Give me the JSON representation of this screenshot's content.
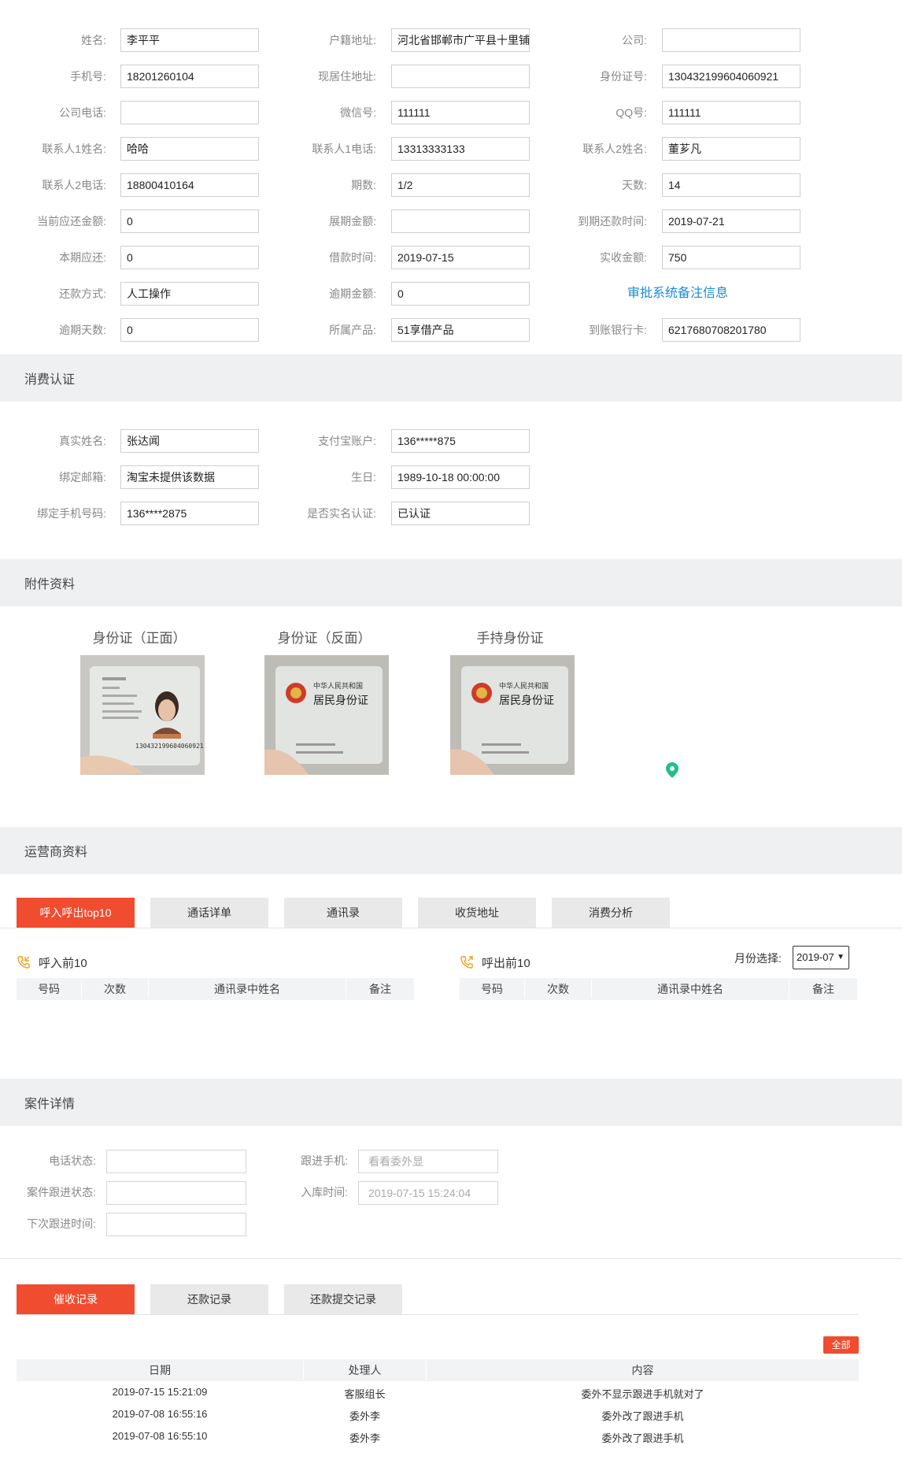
{
  "basic": {
    "name_label": "姓名:",
    "name": "李平平",
    "hukou_label": "户籍地址:",
    "hukou": "河北省邯郸市广平县十里铺",
    "company_label": "公司:",
    "company": "",
    "phone_label": "手机号:",
    "phone": "18201260104",
    "residence_label": "现居住地址:",
    "residence": "",
    "idno_label": "身份证号:",
    "idno": "130432199604060921",
    "company_phone_label": "公司电话:",
    "company_phone": "",
    "wechat_label": "微信号:",
    "wechat": "111111",
    "qq_label": "QQ号:",
    "qq": "111111",
    "contact1_name_label": "联系人1姓名:",
    "contact1_name": "哈哈",
    "contact1_phone_label": "联系人1电话:",
    "contact1_phone": "13313333133",
    "contact2_name_label": "联系人2姓名:",
    "contact2_name": "董芗凡",
    "contact2_phone_label": "联系人2电话:",
    "contact2_phone": "18800410164",
    "period_label": "期数:",
    "period": "1/2",
    "days_label": "天数:",
    "days": "14",
    "current_due_label": "当前应还金额:",
    "current_due": "0",
    "extension_label": "展期金额:",
    "extension": "",
    "due_time_label": "到期还款时间:",
    "due_time": "2019-07-21",
    "this_due_label": "本期应还:",
    "this_due": "0",
    "loan_time_label": "借款时间:",
    "loan_time": "2019-07-15",
    "received_label": "实收金额:",
    "received": "750",
    "repay_method_label": "还款方式:",
    "repay_method": "人工操作",
    "overdue_amount_label": "逾期金额:",
    "overdue_amount": "0",
    "approval_link": "审批系统备注信息",
    "overdue_days_label": "逾期天数:",
    "overdue_days": "0",
    "product_label": "所属产品:",
    "product": "51享借产品",
    "bank_card_label": "到账银行卡:",
    "bank_card": "6217680708201780"
  },
  "consumption": {
    "title": "消费认证",
    "real_name_label": "真实姓名:",
    "real_name": "张达闻",
    "alipay_label": "支付宝账户:",
    "alipay": "136*****875",
    "email_label": "绑定邮箱:",
    "email": "淘宝未提供该数据",
    "birthday_label": "生日:",
    "birthday": "1989-10-18 00:00:00",
    "bind_phone_label": "绑定手机号码:",
    "bind_phone": "136****2875",
    "realname_auth_label": "是否实名认证:",
    "realname_auth": "已认证"
  },
  "attachments": {
    "title": "附件资料",
    "items": [
      {
        "label": "身份证（正面）",
        "type": "front",
        "id_number": "130432199604060921"
      },
      {
        "label": "身份证（反面）",
        "type": "back"
      },
      {
        "label": "手持身份证",
        "type": "back"
      }
    ],
    "card_text": {
      "country": "中华人民共和国",
      "doc": "居民身份证"
    },
    "pin_color": "#1fc08a"
  },
  "operator": {
    "title": "运营商资料",
    "tabs": [
      "呼入呼出top10",
      "通话详单",
      "通讯录",
      "收货地址",
      "消费分析"
    ],
    "incoming_title": "呼入前10",
    "outgoing_title": "呼出前10",
    "month_label": "月份选择:",
    "month_value": "2019-07",
    "columns": [
      "号码",
      "次数",
      "通讯录中姓名",
      "备注"
    ]
  },
  "case": {
    "title": "案件详情",
    "phone_status_label": "电话状态:",
    "phone_status": "",
    "follow_phone_label": "跟进手机:",
    "follow_phone_placeholder": "看看委外显",
    "follow_status_label": "案件跟进状态:",
    "follow_status": "",
    "stored_time_label": "入库时间:",
    "stored_time": "2019-07-15 15:24:04",
    "next_follow_label": "下次跟进时间:",
    "next_follow": ""
  },
  "records": {
    "tabs": [
      "催收记录",
      "还款记录",
      "还款提交记录"
    ],
    "all_badge": "全部",
    "columns": [
      "日期",
      "处理人",
      "内容"
    ],
    "rows": [
      {
        "date": "2019-07-15 15:21:09",
        "handler": "客服组长",
        "content": "委外不显示跟进手机就对了"
      },
      {
        "date": "2019-07-08 16:55:16",
        "handler": "委外李",
        "content": "委外改了跟进手机"
      },
      {
        "date": "2019-07-08 16:55:10",
        "handler": "委外李",
        "content": "委外改了跟进手机"
      }
    ]
  },
  "colors": {
    "accent": "#f04c2f",
    "link": "#1a8ad4",
    "section_bg": "#eef0f2"
  }
}
